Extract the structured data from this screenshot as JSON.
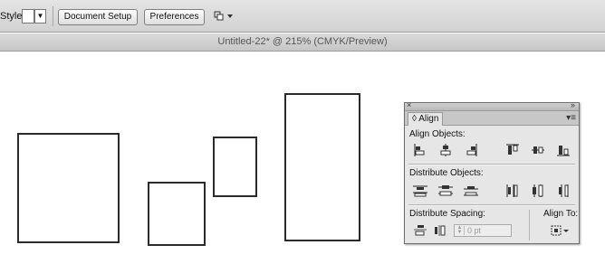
{
  "control_bar": {
    "style_label": "Style:",
    "document_setup_label": "Document Setup",
    "preferences_label": "Preferences"
  },
  "document": {
    "title": "Untitled-22* @ 215% (CMYK/Preview)"
  },
  "align_panel": {
    "tab_label": "Align",
    "align_objects_label": "Align Objects:",
    "distribute_objects_label": "Distribute Objects:",
    "distribute_spacing_label": "Distribute Spacing:",
    "align_to_label": "Align To:",
    "spacing_value": "0 pt"
  },
  "colors": {
    "artwork_stroke": "#2b2b2b",
    "chrome_gray": "#d9d9d9"
  }
}
